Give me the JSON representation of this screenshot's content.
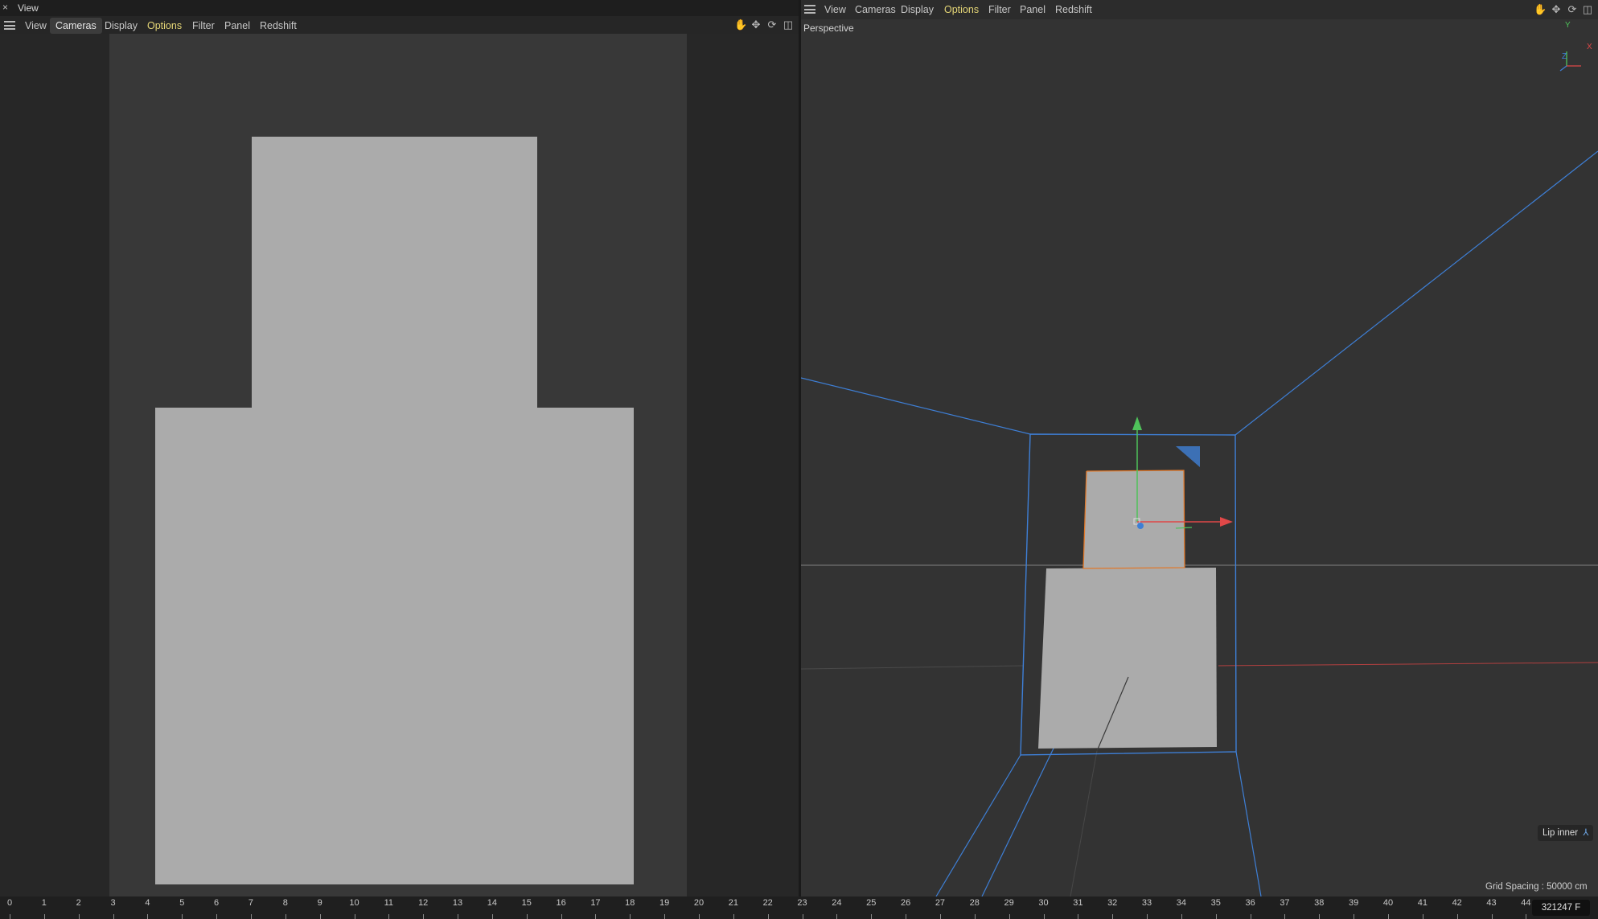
{
  "left_panel": {
    "window_title": "View",
    "close_glyph": "×",
    "menu": [
      "View",
      "Cameras",
      "Display",
      "Options",
      "Filter",
      "Panel",
      "Redshift"
    ],
    "active_menu": "Cameras",
    "highlight_menu": "Options",
    "nav_icons": [
      "hand-move-icon",
      "move-down-icon",
      "rotate-icon",
      "maximize-icon"
    ]
  },
  "right_panel": {
    "menu": [
      "View",
      "Cameras",
      "Display",
      "Options",
      "Filter",
      "Panel",
      "Redshift"
    ],
    "highlight_menu": "Options",
    "nav_icons": [
      "hand-move-icon",
      "move-down-icon",
      "rotate-icon",
      "maximize-icon"
    ],
    "viewport_label": "Perspective",
    "axis_gizmo": {
      "y": "Y",
      "x": "X",
      "z": "Z"
    },
    "selected_object": "Lip inner",
    "grid_spacing": "Grid Spacing : 50000 cm"
  },
  "timeline": {
    "ticks": [
      "0",
      "1",
      "2",
      "3",
      "4",
      "5",
      "6",
      "7",
      "8",
      "9",
      "10",
      "11",
      "12",
      "13",
      "14",
      "15",
      "16",
      "17",
      "18",
      "19",
      "20",
      "21",
      "22",
      "23",
      "24",
      "25",
      "26",
      "27",
      "28",
      "29",
      "30",
      "31",
      "32",
      "33",
      "34",
      "35",
      "36",
      "37",
      "38",
      "39",
      "40",
      "41",
      "42",
      "43",
      "44"
    ],
    "current_frame": "321247 F"
  },
  "colors": {
    "accent_yellow": "#e6d777",
    "camera_blue": "#3e7fd6",
    "axis_red": "#e04848",
    "axis_green": "#4ec25a",
    "selection_orange": "#e0782a",
    "object_gray": "#ababab"
  }
}
